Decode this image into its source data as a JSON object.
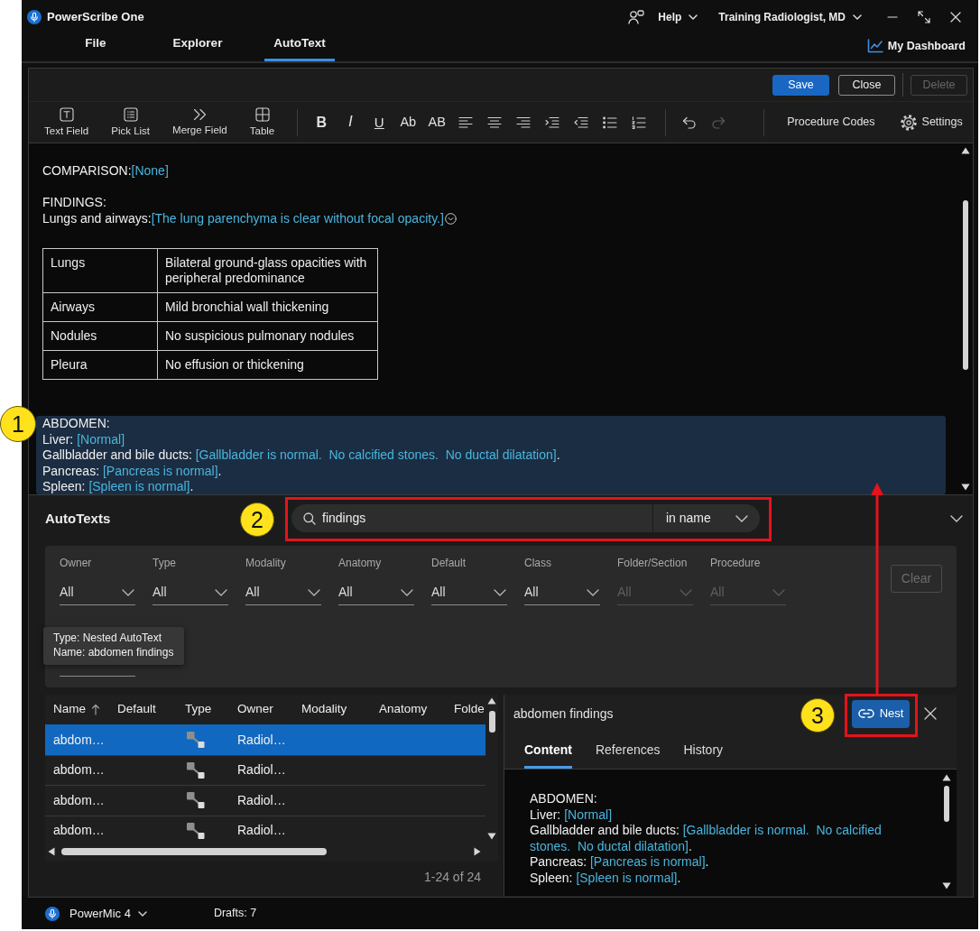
{
  "window": {
    "title": "PowerScribe One"
  },
  "title_bar": {
    "menus": [
      {
        "label": "Help"
      },
      {
        "label": "Training Radiologist, MD"
      }
    ]
  },
  "nav_tabs": [
    {
      "label": "File",
      "selected": false
    },
    {
      "label": "Explorer",
      "selected": false
    },
    {
      "label": "AutoText",
      "selected": true
    }
  ],
  "dashboard_link": "My Dashboard",
  "editor": {
    "actions": [
      {
        "label": "Save",
        "kind": "primary",
        "disabled": false
      },
      {
        "label": "Close",
        "kind": "outline",
        "disabled": false
      },
      {
        "label": "Delete",
        "kind": "outline",
        "disabled": true
      }
    ],
    "insert_tools": [
      {
        "label": "Text Field",
        "kind": "text-field"
      },
      {
        "label": "Pick List",
        "kind": "pick-list"
      },
      {
        "label": "Merge Field",
        "kind": "merge-field"
      },
      {
        "label": "Table",
        "kind": "table"
      }
    ],
    "format_tools": [
      {
        "kind": "bold",
        "glyph": "B"
      },
      {
        "kind": "italic",
        "glyph": "I"
      },
      {
        "kind": "underline",
        "glyph": "U"
      },
      {
        "kind": "title-case",
        "glyph": "Ab"
      },
      {
        "kind": "upper-case",
        "glyph": "AB"
      },
      {
        "kind": "align-left"
      },
      {
        "kind": "align-center"
      },
      {
        "kind": "align-right"
      },
      {
        "kind": "indent"
      },
      {
        "kind": "outdent"
      },
      {
        "kind": "bullets"
      },
      {
        "kind": "numbering"
      }
    ],
    "history_tools": [
      {
        "kind": "undo",
        "disabled": false
      },
      {
        "kind": "redo",
        "disabled": true
      }
    ],
    "extra_tools": [
      {
        "label": "Procedure Codes",
        "kind": "plain"
      },
      {
        "label": "Settings",
        "kind": "settings"
      }
    ],
    "blocks": [
      {
        "kind": "paragraph",
        "highlighted": false,
        "lines": [
          {
            "parts": [
              {
                "kind": "label",
                "text": "COMPARISON:"
              },
              {
                "kind": "field",
                "text": "[None]"
              }
            ]
          }
        ]
      },
      {
        "kind": "paragraph",
        "highlighted": false,
        "lines": [
          {
            "parts": [
              {
                "kind": "label",
                "text": "FINDINGS:"
              }
            ]
          },
          {
            "parts": [
              {
                "kind": "label",
                "text": "Lungs and airways:"
              },
              {
                "kind": "field",
                "text": "[The lung parenchyma is clear without focal opacity.]"
              },
              {
                "kind": "dropdown"
              }
            ]
          }
        ]
      },
      {
        "kind": "table",
        "rows": [
          [
            "Lungs",
            "Bilateral ground-glass opacities with peripheral predominance"
          ],
          [
            "Airways",
            "Mild bronchial wall thickening"
          ],
          [
            "Nodules",
            "No suspicious pulmonary nodules"
          ],
          [
            "Pleura",
            "No effusion or thickening"
          ]
        ]
      },
      {
        "kind": "paragraph",
        "highlighted": true,
        "lines": [
          {
            "parts": [
              {
                "kind": "label",
                "text": "ABDOMEN:"
              }
            ]
          },
          {
            "parts": [
              {
                "kind": "label",
                "text": "Liver: "
              },
              {
                "kind": "field",
                "text": "[Normal]"
              }
            ]
          },
          {
            "parts": [
              {
                "kind": "label",
                "text": "Gallbladder and bile ducts: "
              },
              {
                "kind": "field",
                "text": "[Gallbladder is normal.  No calcified stones.  No ductal dilatation]"
              },
              {
                "kind": "label",
                "text": "."
              }
            ]
          },
          {
            "parts": [
              {
                "kind": "label",
                "text": "Pancreas: "
              },
              {
                "kind": "field",
                "text": "[Pancreas is normal]"
              },
              {
                "kind": "label",
                "text": "."
              }
            ]
          },
          {
            "parts": [
              {
                "kind": "label",
                "text": "Spleen: "
              },
              {
                "kind": "field",
                "text": "[Spleen is normal]"
              },
              {
                "kind": "label",
                "text": "."
              }
            ]
          }
        ]
      }
    ]
  },
  "autotexts": {
    "title": "AutoTexts",
    "search": {
      "value": "findings",
      "scope": "in name"
    },
    "filters": [
      {
        "label": "Owner",
        "value": "All",
        "disabled": false
      },
      {
        "label": "Type",
        "value": "All",
        "disabled": false
      },
      {
        "label": "Modality",
        "value": "All",
        "disabled": false
      },
      {
        "label": "Anatomy",
        "value": "All",
        "disabled": false
      },
      {
        "label": "Default",
        "value": "All",
        "disabled": false
      },
      {
        "label": "Class",
        "value": "All",
        "disabled": false
      },
      {
        "label": "Folder/Section",
        "value": "All",
        "disabled": true
      },
      {
        "label": "Procedure",
        "value": "All",
        "disabled": true
      }
    ],
    "filters_row_2": [
      {
        "disabled": false
      }
    ],
    "clear_button": {
      "label": "Clear",
      "disabled": true
    },
    "tooltip": {
      "lines": [
        "Type: Nested AutoText",
        "Name: abdomen findings"
      ]
    },
    "results": {
      "columns": [
        {
          "label": "Name",
          "sorted": true
        },
        {
          "label": "Default"
        },
        {
          "label": "Type"
        },
        {
          "label": "Owner"
        },
        {
          "label": "Modality"
        },
        {
          "label": "Anatomy"
        },
        {
          "label": "Folde"
        }
      ],
      "rows": [
        {
          "name": "abdom…",
          "kind": "nested",
          "owner": "Radiol…",
          "selected": true
        },
        {
          "name": "abdom…",
          "kind": "nested",
          "owner": "Radiol…",
          "selected": false
        },
        {
          "name": "abdom…",
          "kind": "nested",
          "owner": "Radiol…",
          "selected": false
        },
        {
          "name": "abdom…",
          "kind": "nested",
          "owner": "Radiol…",
          "selected": false
        }
      ],
      "pager": "1-24 of 24"
    },
    "preview": {
      "title": "abdomen findings",
      "nest_button": "Nest",
      "tabs": [
        {
          "label": "Content",
          "selected": true
        },
        {
          "label": "References",
          "selected": false
        },
        {
          "label": "History",
          "selected": false
        }
      ],
      "lines": [
        {
          "parts": [
            {
              "kind": "label",
              "text": "ABDOMEN:"
            }
          ]
        },
        {
          "parts": [
            {
              "kind": "label",
              "text": "Liver: "
            },
            {
              "kind": "field",
              "text": "[Normal]"
            }
          ]
        },
        {
          "parts": [
            {
              "kind": "label",
              "text": "Gallbladder and bile ducts: "
            },
            {
              "kind": "field",
              "text": "[Gallbladder is normal.  No calcified stones.  No ductal dilatation]"
            },
            {
              "kind": "label",
              "text": "."
            }
          ]
        },
        {
          "parts": [
            {
              "kind": "label",
              "text": "Pancreas: "
            },
            {
              "kind": "field",
              "text": "[Pancreas is normal]"
            },
            {
              "kind": "label",
              "text": "."
            }
          ]
        },
        {
          "parts": [
            {
              "kind": "label",
              "text": "Spleen: "
            },
            {
              "kind": "field",
              "text": "[Spleen is normal]"
            },
            {
              "kind": "label",
              "text": "."
            }
          ]
        }
      ]
    }
  },
  "status_bar": {
    "device": "PowerMic 4",
    "drafts": "Drafts: 7"
  },
  "callouts": [
    {
      "label": "1"
    },
    {
      "label": "2"
    },
    {
      "label": "3"
    }
  ]
}
